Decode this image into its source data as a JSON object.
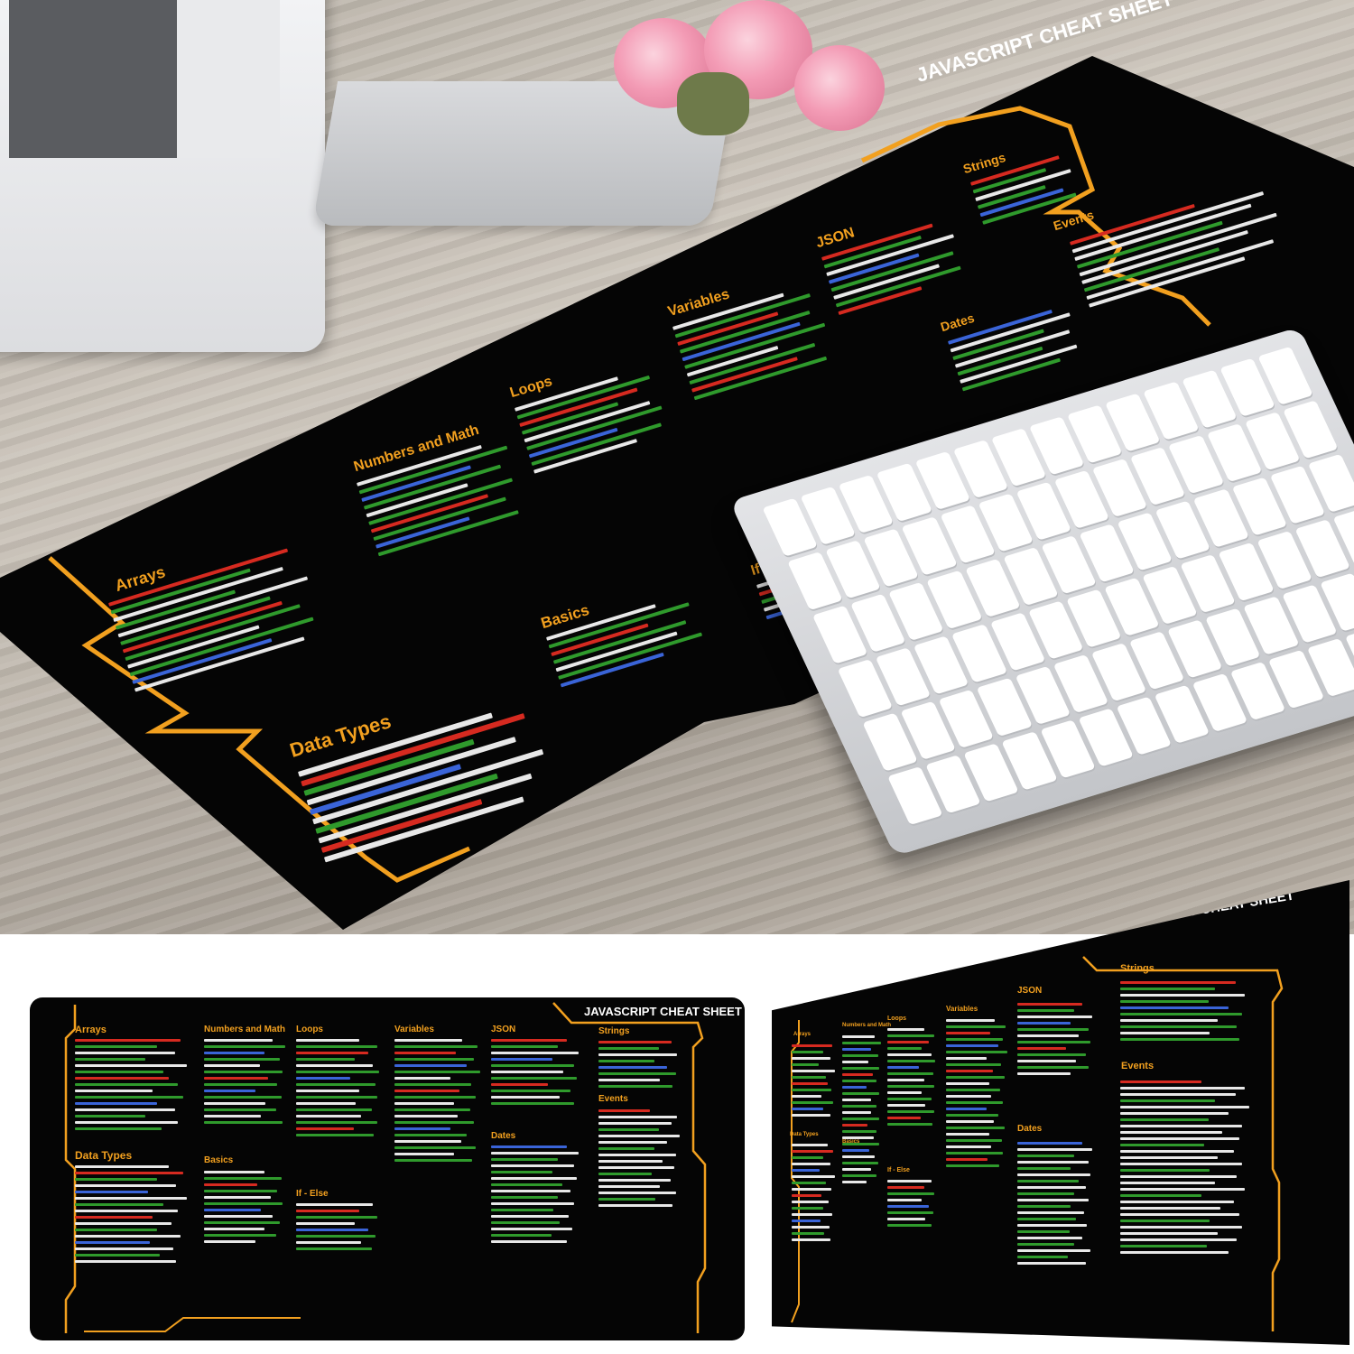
{
  "hero": {
    "pad_title": "JAVASCRIPT CHEAT SHEET",
    "sections": [
      {
        "key": "arrays",
        "label": "Arrays"
      },
      {
        "key": "numbers",
        "label": "Numbers and Math"
      },
      {
        "key": "loops",
        "label": "Loops"
      },
      {
        "key": "variables",
        "label": "Variables"
      },
      {
        "key": "json",
        "label": "JSON"
      },
      {
        "key": "strings",
        "label": "Strings"
      },
      {
        "key": "events",
        "label": "Events"
      },
      {
        "key": "dates",
        "label": "Dates"
      },
      {
        "key": "basics",
        "label": "Basics"
      },
      {
        "key": "ifelse",
        "label": "If - Else"
      },
      {
        "key": "datatypes",
        "label": "Data Types"
      }
    ]
  },
  "thumb_flat": {
    "title": "JAVASCRIPT CHEAT SHEET",
    "sections": [
      "Arrays",
      "Numbers and Math",
      "Loops",
      "Variables",
      "JSON",
      "Strings",
      "Events",
      "Data Types",
      "Basics",
      "If - Else",
      "Dates"
    ]
  },
  "thumb_persp": {
    "title": "JAVASCRIPT CHEAT SHEET",
    "sections": [
      "Arrays",
      "Numbers and Math",
      "Loops",
      "Variables",
      "JSON",
      "Strings",
      "Events",
      "Dates",
      "Data Types",
      "Basics",
      "If - Else"
    ]
  },
  "colors": {
    "pad_background": "#050505",
    "accent_orange": "#f2a01f",
    "code_green": "#2f9a2c",
    "code_white": "#e8e8e8",
    "code_red": "#d62a20",
    "code_blue": "#3a64d8",
    "title_white": "#ffffff"
  }
}
